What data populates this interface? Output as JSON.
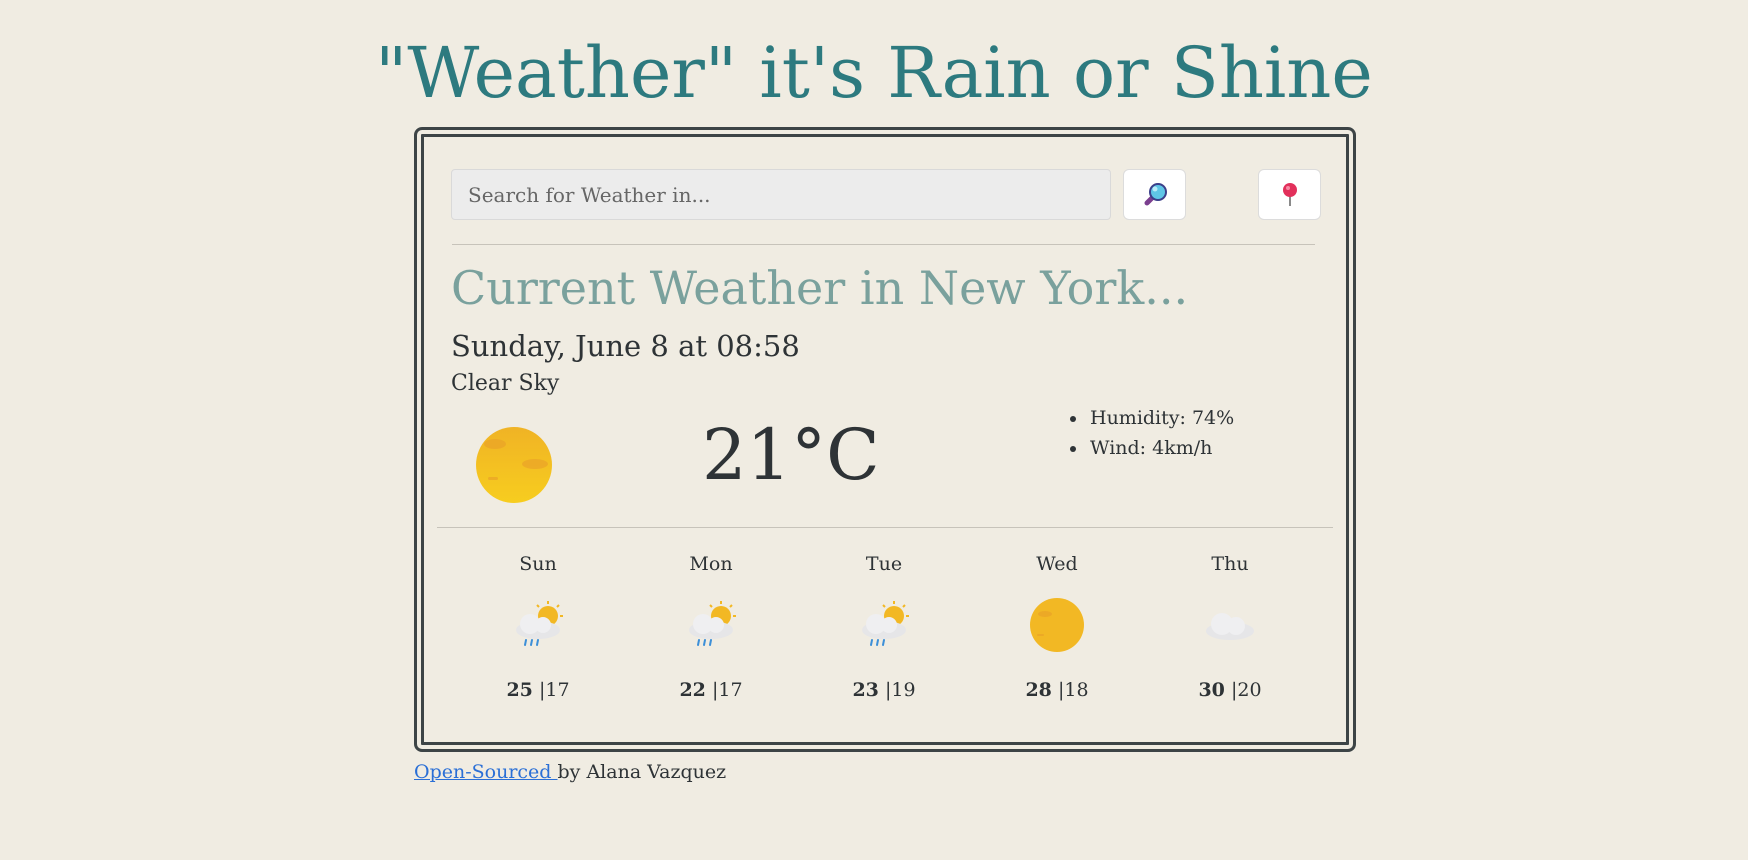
{
  "app": {
    "title": "\"Weather\" it's Rain or Shine"
  },
  "search": {
    "placeholder": "Search for Weather in...",
    "value": ""
  },
  "current": {
    "heading": "Current Weather in New York...",
    "date": "Sunday, June 8 at 08:58",
    "condition": "Clear Sky",
    "temperature": "21°C",
    "icon": "sun-icon",
    "details": [
      "Humidity: 74%",
      "Wind: 4km/h"
    ]
  },
  "forecast": [
    {
      "day": "Sun",
      "icon": "rain-sun-icon",
      "max": "25",
      "min": "|17"
    },
    {
      "day": "Mon",
      "icon": "rain-sun-icon",
      "max": "22",
      "min": "|17"
    },
    {
      "day": "Tue",
      "icon": "rain-sun-icon",
      "max": "23",
      "min": "|19"
    },
    {
      "day": "Wed",
      "icon": "sun-icon",
      "max": "28",
      "min": "|18"
    },
    {
      "day": "Thu",
      "icon": "cloud-icon",
      "max": "30",
      "min": "|20"
    }
  ],
  "footer": {
    "link_text": "Open-Sourced ",
    "credit": " by Alana Vazquez"
  },
  "colors": {
    "background": "#f0ece2",
    "title": "#2d7a7f",
    "heading": "#7aa19d",
    "link": "#2a6fd6",
    "border": "#3d4446"
  }
}
